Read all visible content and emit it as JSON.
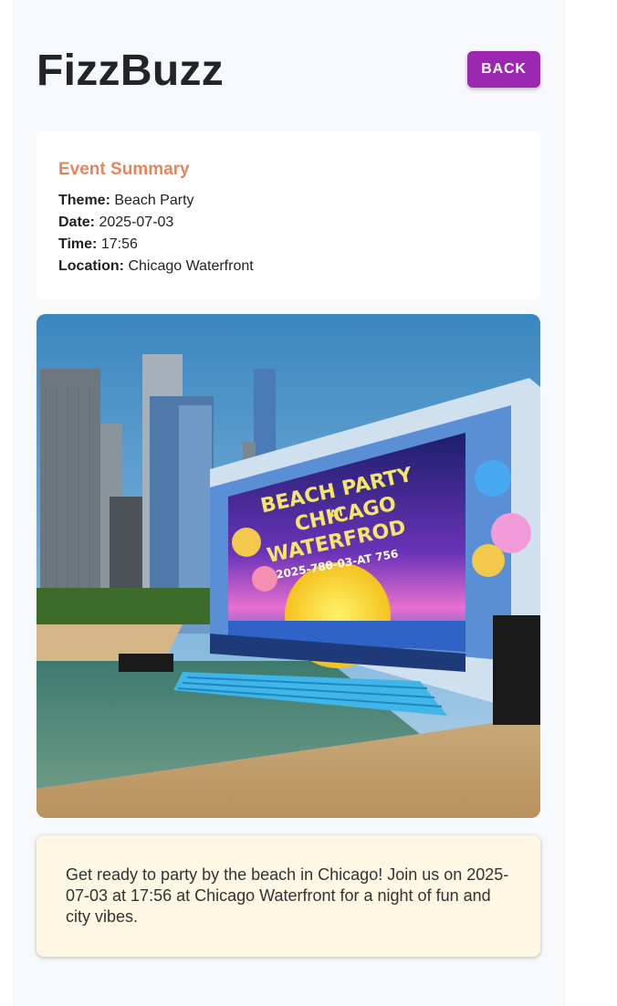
{
  "header": {
    "title": "FizzBuzz",
    "back_label": "BACK"
  },
  "summary": {
    "heading": "Event Summary",
    "theme_label": "Theme:",
    "theme_value": "Beach Party",
    "date_label": "Date:",
    "date_value": "2025-07-03",
    "time_label": "Time:",
    "time_value": "17:56",
    "location_label": "Location:",
    "location_value": "Chicago Waterfront"
  },
  "image": {
    "banner_line1": "BEACH PARTY",
    "banner_line2": "AT",
    "banner_line3": "CHICAGO",
    "banner_line4": "WATERFROD",
    "banner_date": "2025-78θ-03-AT 756"
  },
  "description": {
    "text": "Get ready to party by the beach in Chicago! Join us on 2025-07-03 at 17:56 at Chicago Waterfront for a night of fun and city vibes."
  },
  "colors": {
    "accent": "#9c27b0",
    "summary_heading": "#e8845a",
    "description_bg": "#fdf7e3"
  }
}
